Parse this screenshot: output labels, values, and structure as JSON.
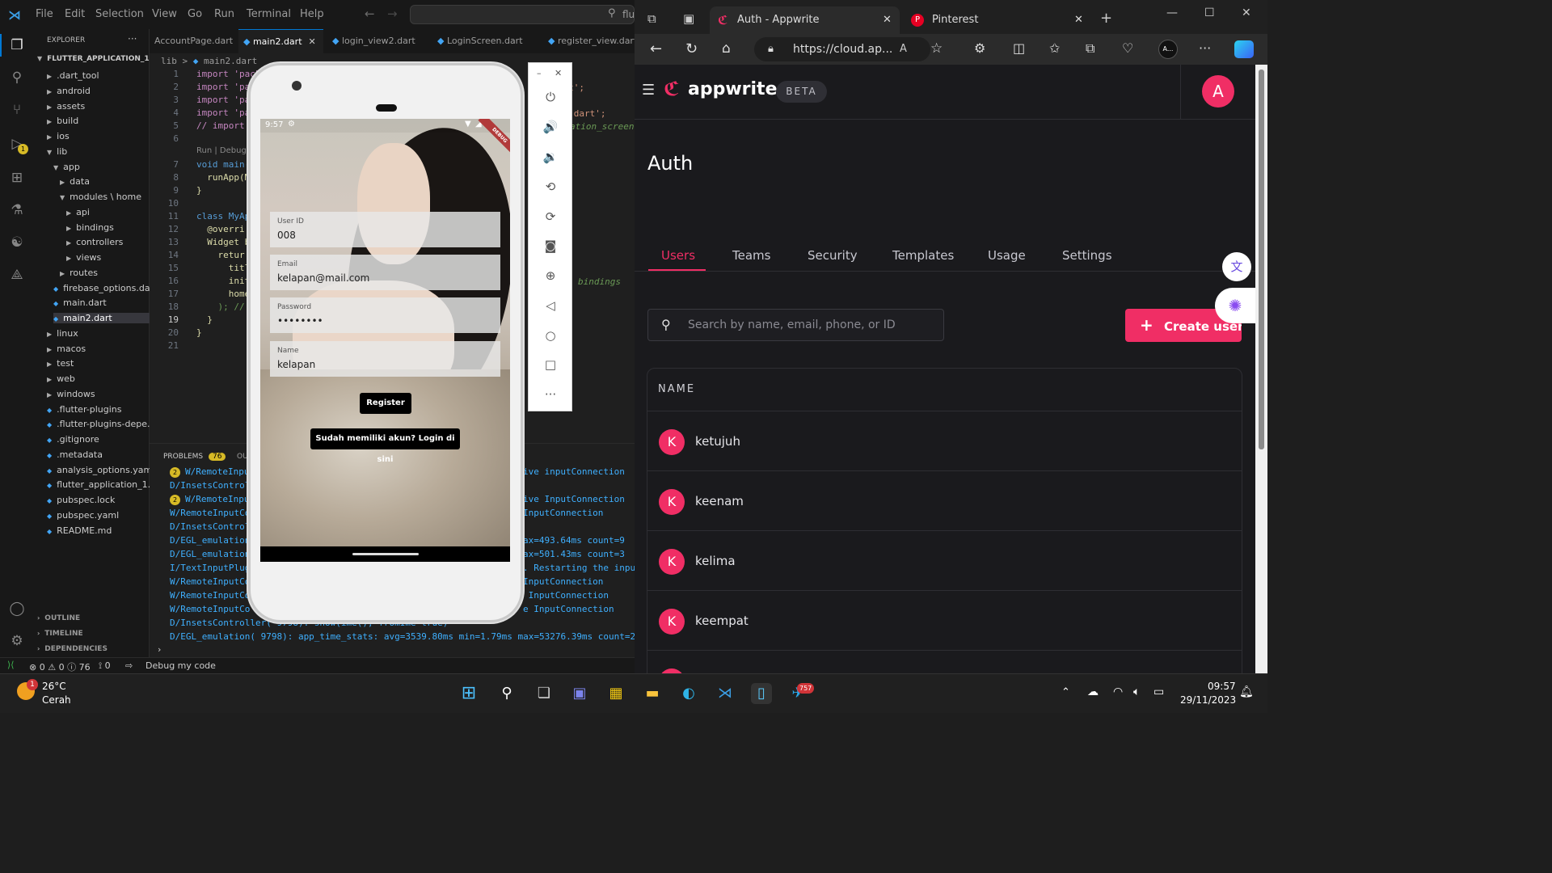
{
  "vscode": {
    "menu": [
      "File",
      "Edit",
      "Selection",
      "View",
      "Go",
      "Run",
      "Terminal",
      "Help"
    ],
    "search_text": "flu",
    "explorer": {
      "header": "EXPLORER",
      "project": "FLUTTER_APPLICATION_1",
      "items": [
        ".dart_tool",
        "android",
        "assets",
        "build",
        "ios",
        "lib",
        "app",
        "data",
        "modules \\ home",
        "api",
        "bindings",
        "controllers",
        "views",
        "routes",
        "firebase_options.dart",
        "main.dart",
        "main2.dart",
        "linux",
        "macos",
        "test",
        "web",
        "windows",
        ".flutter-plugins",
        ".flutter-plugins-depe...",
        ".gitignore",
        ".metadata",
        "analysis_options.yaml",
        "flutter_application_1.i...",
        "pubspec.lock",
        "pubspec.yaml",
        "README.md"
      ],
      "sections": [
        "OUTLINE",
        "TIMELINE",
        "DEPENDENCIES"
      ]
    },
    "tabs": [
      "AccountPage.dart",
      "main2.dart",
      "login_view2.dart",
      "LoginScreen.dart",
      "register_view.dart"
    ],
    "breadcrumb": {
      "folder": "lib",
      "file": "main2.dart"
    },
    "code_lines": [
      "import 'pack",
      "import 'pa",
      "import 'pa",
      "import 'pa",
      "// import",
      "",
      "void main(",
      "  runApp(M",
      "}",
      "",
      "class MyAp",
      "  @overri",
      "  Widget b",
      "    retur",
      "      titl",
      "      init",
      "      home",
      "    ); //",
      "  }",
      "}",
      ""
    ],
    "code_right": {
      "line2": "e.dart';",
      "line4": "nding.dart';",
      "line5": "ation_screen",
      "line16": "bindings"
    },
    "codelens": "Run | Debug",
    "problems": {
      "label": "PROBLEMS",
      "count": "76",
      "output": "OU"
    },
    "logs": [
      "W/RemoteInpu",
      "D/InsetsControl",
      "W/RemoteInpu",
      "W/RemoteInputCo",
      "D/InsetsControl",
      "D/EGL_emulation",
      "D/EGL_emulation",
      "I/TextInputPlug",
      "W/RemoteInputCo",
      "W/RemoteInputCo",
      "W/RemoteInputCo",
      "D/InsetsController( 9798): show(ime(), fromIme=true)",
      "D/EGL_emulation( 9798): app_time_stats: avg=3539.80ms min=1.79ms max=53276.39ms count=20"
    ],
    "logs_right": [
      "ive inputConnection",
      "",
      "ive InputConnection",
      "InputConnection",
      "",
      "ax=493.64ms count=9",
      "ax=501.43ms count=3",
      ". Restarting the inpu",
      "InputConnection",
      " InputConnection",
      "e InputConnection",
      "",
      ""
    ],
    "log_badge": "2",
    "status": {
      "errors": "0",
      "warnings": "0",
      "infos": "76",
      "ports": "0",
      "debug": "Debug my code"
    },
    "activity_badge": "1"
  },
  "phone": {
    "time": "9:57",
    "debug_banner": "DEBUG",
    "fields": [
      {
        "label": "User ID",
        "value": "008"
      },
      {
        "label": "Email",
        "value": "kelapan@mail.com"
      },
      {
        "label": "Password",
        "value": "••••••••"
      },
      {
        "label": "Name",
        "value": "kelapan"
      }
    ],
    "register_button": "Register",
    "login_link_button": "Sudah memiliki akun? Login di sini"
  },
  "edge": {
    "tabs": [
      {
        "title": "Auth - Appwrite"
      },
      {
        "title": "Pinterest"
      }
    ],
    "url": "https://cloud.ap...",
    "profile": "A..."
  },
  "appwrite": {
    "brand": "appwrite",
    "beta": "BETA",
    "avatar": "A",
    "page_title": "Auth",
    "tabs": [
      "Users",
      "Teams",
      "Security",
      "Templates",
      "Usage",
      "Settings"
    ],
    "search_placeholder": "Search by name, email, phone, or ID",
    "create_button": "Create user",
    "column_header": "NAME",
    "users": [
      {
        "initial": "K",
        "name": "ketujuh"
      },
      {
        "initial": "K",
        "name": "keenam"
      },
      {
        "initial": "K",
        "name": "kelima"
      },
      {
        "initial": "K",
        "name": "keempat"
      }
    ],
    "accent_color": "#f02e65"
  },
  "taskbar": {
    "weather_temp": "26°C",
    "weather_desc": "Cerah",
    "weather_badge": "1",
    "telegram_badge": "757",
    "time": "09:57",
    "date": "29/11/2023"
  }
}
